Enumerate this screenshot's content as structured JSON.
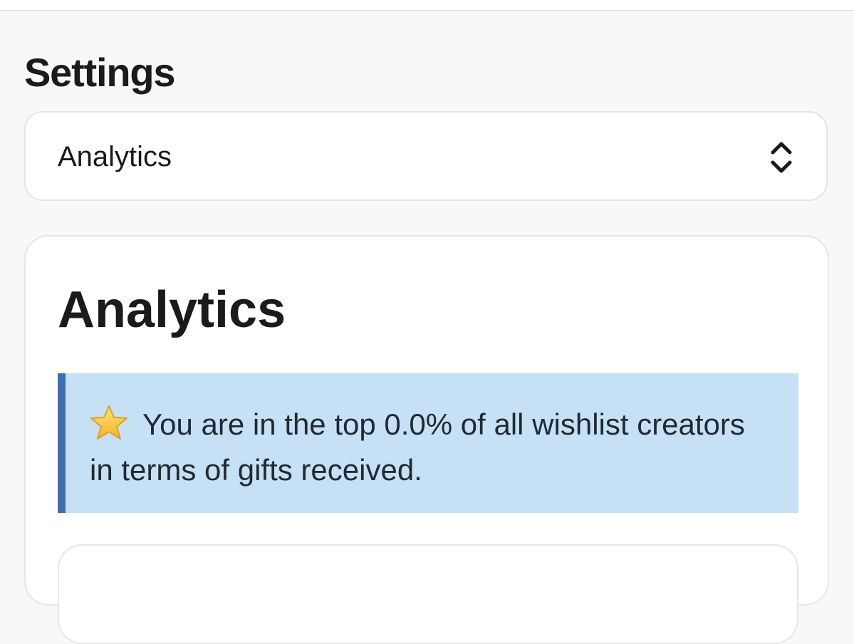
{
  "header": {
    "title": "Settings"
  },
  "section_select": {
    "value": "Analytics",
    "icon": "chevron-up-down-icon"
  },
  "analytics_card": {
    "title": "Analytics",
    "callout": {
      "icon": "star-icon",
      "text": "You are in the top 0.0% of all wishlist creators in terms of gifts received.",
      "background": "#c6e0f5",
      "accent": "#3f6fb3"
    }
  },
  "colors": {
    "page_background": "#f8f8f8",
    "card_background": "#ffffff",
    "text": "#1a1a1a"
  }
}
